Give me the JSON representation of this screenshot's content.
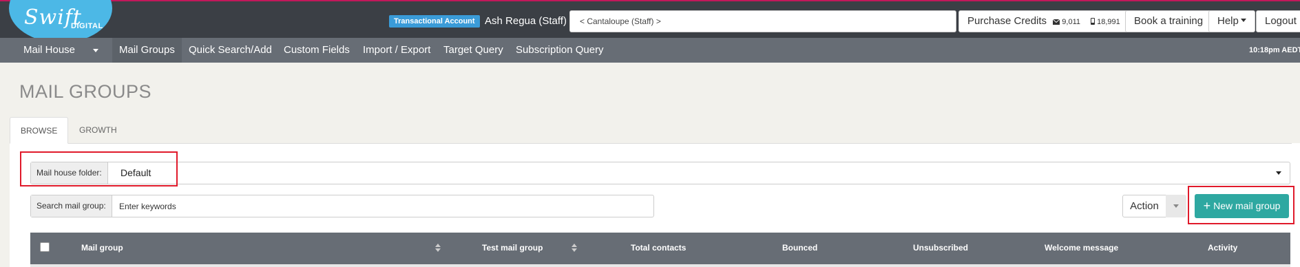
{
  "brand": {
    "logo_text": "Swift",
    "logo_sub": "DIGITAL"
  },
  "topbar": {
    "account_badge": "Transactional Account",
    "user_name": "Ash Regua (Staff)",
    "account_selector": "< Cantaloupe (Staff) >",
    "purchase_credits_label": "Purchase Credits",
    "email_credits": "9,011",
    "sms_credits": "18,991",
    "book_training_label": "Book a training",
    "help_label": "Help",
    "logout_label": "Logout"
  },
  "nav": {
    "items": [
      {
        "label": "Mail House"
      },
      {
        "label": "Mail Groups"
      },
      {
        "label": "Quick Search/Add"
      },
      {
        "label": "Custom Fields"
      },
      {
        "label": "Import / Export"
      },
      {
        "label": "Target Query"
      },
      {
        "label": "Subscription Query"
      }
    ],
    "active_index": 1,
    "clock": "10:18pm AEDT"
  },
  "page": {
    "title": "MAIL GROUPS",
    "tabs": [
      {
        "label": "BROWSE"
      },
      {
        "label": "GROWTH"
      }
    ],
    "active_tab": "BROWSE"
  },
  "filters": {
    "folder_label": "Mail house folder:",
    "folder_value": "Default",
    "search_label": "Search mail group:",
    "search_placeholder": "Enter keywords"
  },
  "actions": {
    "action_label": "Action",
    "new_group_label": "New mail group"
  },
  "table": {
    "columns": [
      "Mail group",
      "Test mail group",
      "Total contacts",
      "Bounced",
      "Unsubscribed",
      "Welcome message",
      "Activity"
    ]
  },
  "colors": {
    "topbar": "#3b3f45",
    "navbar": "#676d75",
    "logo": "#4cb8e6",
    "accent_button": "#2ea8a1",
    "highlight": "#e0192a",
    "badge": "#3a9bd8"
  }
}
